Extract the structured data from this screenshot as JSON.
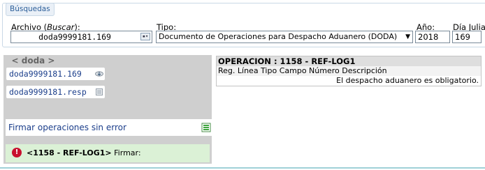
{
  "search": {
    "legend": "Búsquedas",
    "file_label_prefix": "Archivo (",
    "file_label_em": "Buscar",
    "file_label_suffix": "):",
    "file_value": "doda9999181.169",
    "type_label": "Tipo:",
    "type_value": "Documento de Operaciones para Despacho Aduanero (DODA)",
    "year_label": "Año:",
    "year_value": "2018",
    "day_label": "Día Julia",
    "day_value": "169"
  },
  "left_panel": {
    "title": "< doda >",
    "files": [
      {
        "name": "doda9999181.169"
      },
      {
        "name": "doda9999181.resp"
      }
    ],
    "action_label": "Firmar operaciones sin error",
    "error": {
      "op": "<1158 - REF-LOG1>",
      "text": "Firmar:"
    }
  },
  "operation": {
    "title": "OPERACION : 1158 - REF-LOG1",
    "header": "Reg. Línea Tipo Campo Número Descripción",
    "message": "El despacho aduanero es obligatorio."
  },
  "colors": {
    "legend_text": "#2d5f9a",
    "link_text": "#1a3d8a",
    "error_bg": "#dbf1d6",
    "error_icon": "#c8102e",
    "panel_gray": "#cfcfcf"
  },
  "icons": {
    "file_browse": "browse-icon",
    "file_1": "cloud-download-icon",
    "file_2": "document-icon",
    "action": "sign-list-icon",
    "error": "error-icon"
  }
}
